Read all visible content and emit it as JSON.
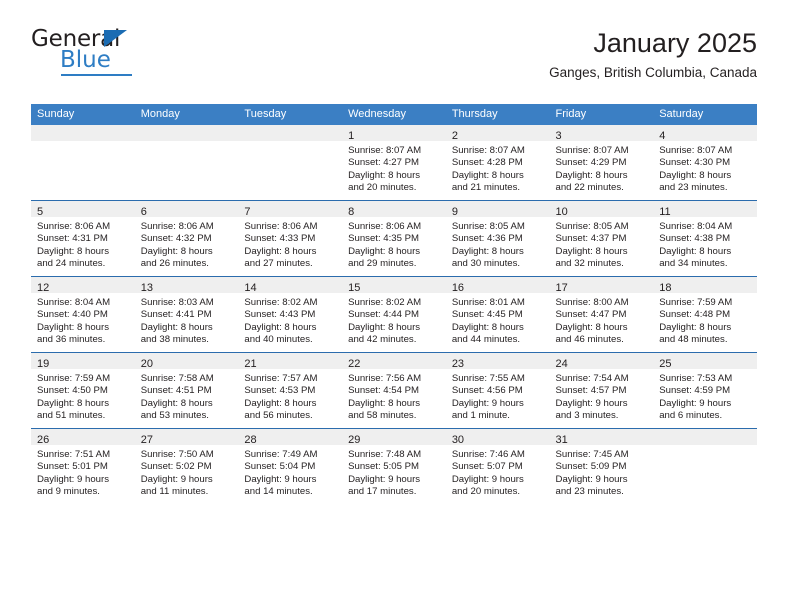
{
  "brand": {
    "name_part1": "General",
    "name_part2": "Blue",
    "triangle_color": "#1b6cb3",
    "blue_color": "#2e7dc4"
  },
  "header": {
    "title": "January 2025",
    "subtitle": "Ganges, British Columbia, Canada"
  },
  "theme": {
    "header_blue": "#3b7fc4",
    "row_divider_blue": "#2b6cad",
    "daynum_band_gray": "#efefef",
    "text_color": "#231f20"
  },
  "weekday_headers": [
    "Sunday",
    "Monday",
    "Tuesday",
    "Wednesday",
    "Thursday",
    "Friday",
    "Saturday"
  ],
  "weeks": [
    [
      {
        "day": "",
        "lines": []
      },
      {
        "day": "",
        "lines": []
      },
      {
        "day": "",
        "lines": []
      },
      {
        "day": "1",
        "lines": [
          "Sunrise: 8:07 AM",
          "Sunset: 4:27 PM",
          "Daylight: 8 hours",
          "and 20 minutes."
        ]
      },
      {
        "day": "2",
        "lines": [
          "Sunrise: 8:07 AM",
          "Sunset: 4:28 PM",
          "Daylight: 8 hours",
          "and 21 minutes."
        ]
      },
      {
        "day": "3",
        "lines": [
          "Sunrise: 8:07 AM",
          "Sunset: 4:29 PM",
          "Daylight: 8 hours",
          "and 22 minutes."
        ]
      },
      {
        "day": "4",
        "lines": [
          "Sunrise: 8:07 AM",
          "Sunset: 4:30 PM",
          "Daylight: 8 hours",
          "and 23 minutes."
        ]
      }
    ],
    [
      {
        "day": "5",
        "lines": [
          "Sunrise: 8:06 AM",
          "Sunset: 4:31 PM",
          "Daylight: 8 hours",
          "and 24 minutes."
        ]
      },
      {
        "day": "6",
        "lines": [
          "Sunrise: 8:06 AM",
          "Sunset: 4:32 PM",
          "Daylight: 8 hours",
          "and 26 minutes."
        ]
      },
      {
        "day": "7",
        "lines": [
          "Sunrise: 8:06 AM",
          "Sunset: 4:33 PM",
          "Daylight: 8 hours",
          "and 27 minutes."
        ]
      },
      {
        "day": "8",
        "lines": [
          "Sunrise: 8:06 AM",
          "Sunset: 4:35 PM",
          "Daylight: 8 hours",
          "and 29 minutes."
        ]
      },
      {
        "day": "9",
        "lines": [
          "Sunrise: 8:05 AM",
          "Sunset: 4:36 PM",
          "Daylight: 8 hours",
          "and 30 minutes."
        ]
      },
      {
        "day": "10",
        "lines": [
          "Sunrise: 8:05 AM",
          "Sunset: 4:37 PM",
          "Daylight: 8 hours",
          "and 32 minutes."
        ]
      },
      {
        "day": "11",
        "lines": [
          "Sunrise: 8:04 AM",
          "Sunset: 4:38 PM",
          "Daylight: 8 hours",
          "and 34 minutes."
        ]
      }
    ],
    [
      {
        "day": "12",
        "lines": [
          "Sunrise: 8:04 AM",
          "Sunset: 4:40 PM",
          "Daylight: 8 hours",
          "and 36 minutes."
        ]
      },
      {
        "day": "13",
        "lines": [
          "Sunrise: 8:03 AM",
          "Sunset: 4:41 PM",
          "Daylight: 8 hours",
          "and 38 minutes."
        ]
      },
      {
        "day": "14",
        "lines": [
          "Sunrise: 8:02 AM",
          "Sunset: 4:43 PM",
          "Daylight: 8 hours",
          "and 40 minutes."
        ]
      },
      {
        "day": "15",
        "lines": [
          "Sunrise: 8:02 AM",
          "Sunset: 4:44 PM",
          "Daylight: 8 hours",
          "and 42 minutes."
        ]
      },
      {
        "day": "16",
        "lines": [
          "Sunrise: 8:01 AM",
          "Sunset: 4:45 PM",
          "Daylight: 8 hours",
          "and 44 minutes."
        ]
      },
      {
        "day": "17",
        "lines": [
          "Sunrise: 8:00 AM",
          "Sunset: 4:47 PM",
          "Daylight: 8 hours",
          "and 46 minutes."
        ]
      },
      {
        "day": "18",
        "lines": [
          "Sunrise: 7:59 AM",
          "Sunset: 4:48 PM",
          "Daylight: 8 hours",
          "and 48 minutes."
        ]
      }
    ],
    [
      {
        "day": "19",
        "lines": [
          "Sunrise: 7:59 AM",
          "Sunset: 4:50 PM",
          "Daylight: 8 hours",
          "and 51 minutes."
        ]
      },
      {
        "day": "20",
        "lines": [
          "Sunrise: 7:58 AM",
          "Sunset: 4:51 PM",
          "Daylight: 8 hours",
          "and 53 minutes."
        ]
      },
      {
        "day": "21",
        "lines": [
          "Sunrise: 7:57 AM",
          "Sunset: 4:53 PM",
          "Daylight: 8 hours",
          "and 56 minutes."
        ]
      },
      {
        "day": "22",
        "lines": [
          "Sunrise: 7:56 AM",
          "Sunset: 4:54 PM",
          "Daylight: 8 hours",
          "and 58 minutes."
        ]
      },
      {
        "day": "23",
        "lines": [
          "Sunrise: 7:55 AM",
          "Sunset: 4:56 PM",
          "Daylight: 9 hours",
          "and 1 minute."
        ]
      },
      {
        "day": "24",
        "lines": [
          "Sunrise: 7:54 AM",
          "Sunset: 4:57 PM",
          "Daylight: 9 hours",
          "and 3 minutes."
        ]
      },
      {
        "day": "25",
        "lines": [
          "Sunrise: 7:53 AM",
          "Sunset: 4:59 PM",
          "Daylight: 9 hours",
          "and 6 minutes."
        ]
      }
    ],
    [
      {
        "day": "26",
        "lines": [
          "Sunrise: 7:51 AM",
          "Sunset: 5:01 PM",
          "Daylight: 9 hours",
          "and 9 minutes."
        ]
      },
      {
        "day": "27",
        "lines": [
          "Sunrise: 7:50 AM",
          "Sunset: 5:02 PM",
          "Daylight: 9 hours",
          "and 11 minutes."
        ]
      },
      {
        "day": "28",
        "lines": [
          "Sunrise: 7:49 AM",
          "Sunset: 5:04 PM",
          "Daylight: 9 hours",
          "and 14 minutes."
        ]
      },
      {
        "day": "29",
        "lines": [
          "Sunrise: 7:48 AM",
          "Sunset: 5:05 PM",
          "Daylight: 9 hours",
          "and 17 minutes."
        ]
      },
      {
        "day": "30",
        "lines": [
          "Sunrise: 7:46 AM",
          "Sunset: 5:07 PM",
          "Daylight: 9 hours",
          "and 20 minutes."
        ]
      },
      {
        "day": "31",
        "lines": [
          "Sunrise: 7:45 AM",
          "Sunset: 5:09 PM",
          "Daylight: 9 hours",
          "and 23 minutes."
        ]
      },
      {
        "day": "",
        "lines": []
      }
    ]
  ]
}
